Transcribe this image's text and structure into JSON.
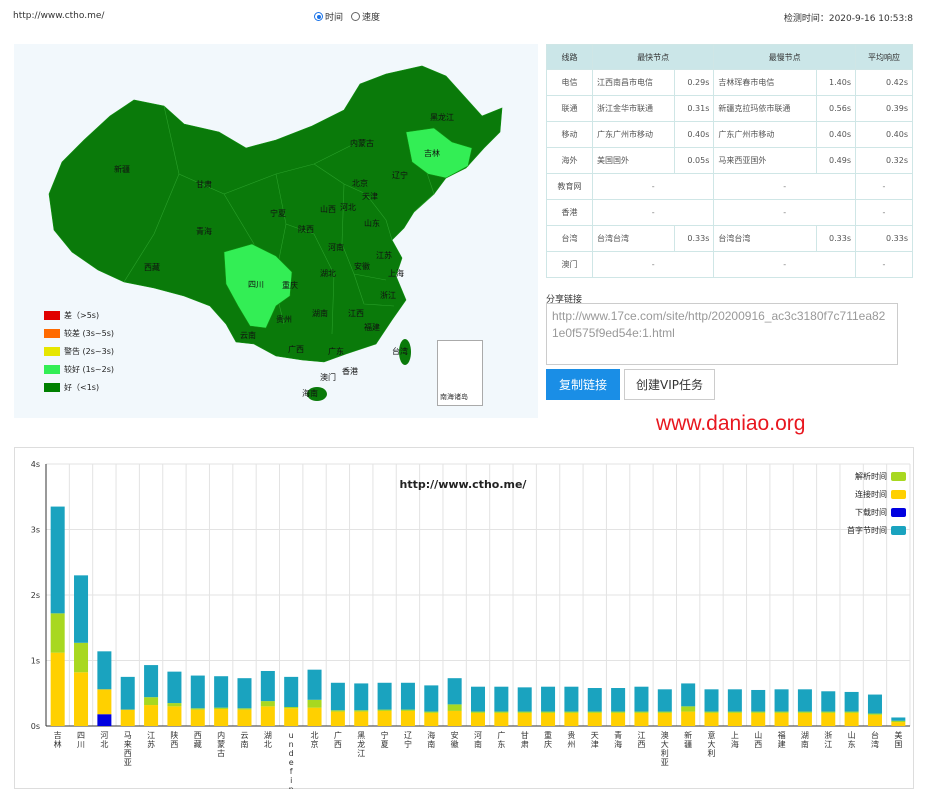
{
  "header": {
    "url": "http://www.ctho.me/",
    "radio_time": "时间",
    "radio_speed": "速度",
    "detect_time": "检测时间：2020-9-16 10:53:8"
  },
  "map": {
    "provinces": [
      {
        "name": "新疆",
        "status": "good"
      },
      {
        "name": "西藏",
        "status": "good"
      },
      {
        "name": "青海",
        "status": "good"
      },
      {
        "name": "甘肃",
        "status": "good"
      },
      {
        "name": "内蒙古",
        "status": "good"
      },
      {
        "name": "黑龙江",
        "status": "good"
      },
      {
        "name": "吉林",
        "status": "fair"
      },
      {
        "name": "辽宁",
        "status": "good"
      },
      {
        "name": "北京",
        "status": "good"
      },
      {
        "name": "天津",
        "status": "good"
      },
      {
        "name": "河北",
        "status": "good"
      },
      {
        "name": "山西",
        "status": "good"
      },
      {
        "name": "宁夏",
        "status": "good"
      },
      {
        "name": "陕西",
        "status": "good"
      },
      {
        "name": "山东",
        "status": "good"
      },
      {
        "name": "河南",
        "status": "good"
      },
      {
        "name": "江苏",
        "status": "good"
      },
      {
        "name": "安徽",
        "status": "good"
      },
      {
        "name": "上海",
        "status": "good"
      },
      {
        "name": "湖北",
        "status": "good"
      },
      {
        "name": "重庆",
        "status": "good"
      },
      {
        "name": "四川",
        "status": "fair"
      },
      {
        "name": "浙江",
        "status": "good"
      },
      {
        "name": "江西",
        "status": "good"
      },
      {
        "name": "湖南",
        "status": "good"
      },
      {
        "name": "贵州",
        "status": "good"
      },
      {
        "name": "福建",
        "status": "good"
      },
      {
        "name": "台湾",
        "status": "good"
      },
      {
        "name": "云南",
        "status": "good"
      },
      {
        "name": "广西",
        "status": "good"
      },
      {
        "name": "广东",
        "status": "good"
      },
      {
        "name": "香港",
        "status": "good"
      },
      {
        "name": "澳门",
        "status": "good"
      },
      {
        "name": "海南",
        "status": "good"
      }
    ],
    "inset_label": "南海诸岛",
    "legend": [
      {
        "label": "差（>5s)",
        "color": "#e00000"
      },
      {
        "label": "较差 (3s~5s)",
        "color": "#ff6a00"
      },
      {
        "label": "警告 (2s~3s)",
        "color": "#e6e600"
      },
      {
        "label": "较好 (1s~2s)",
        "color": "#33ee55"
      },
      {
        "label": "好（<1s)",
        "color": "#008000"
      }
    ]
  },
  "table": {
    "headers": [
      "线路",
      "最快节点",
      "最慢节点",
      "平均响应"
    ],
    "rows": [
      {
        "line": "电信",
        "fast_node": "江西南昌市电信",
        "fast_time": "0.29s",
        "slow_node": "吉林珲春市电信",
        "slow_time": "1.40s",
        "avg": "0.42s"
      },
      {
        "line": "联通",
        "fast_node": "浙江金华市联通",
        "fast_time": "0.31s",
        "slow_node": "新疆克拉玛依市联通",
        "slow_time": "0.56s",
        "avg": "0.39s"
      },
      {
        "line": "移动",
        "fast_node": "广东广州市移动",
        "fast_time": "0.40s",
        "slow_node": "广东广州市移动",
        "slow_time": "0.40s",
        "avg": "0.40s"
      },
      {
        "line": "海外",
        "fast_node": "美国国外",
        "fast_time": "0.05s",
        "slow_node": "马来西亚国外",
        "slow_time": "0.49s",
        "avg": "0.32s"
      },
      {
        "line": "教育网",
        "fast_node": "-",
        "fast_time": "",
        "slow_node": "-",
        "slow_time": "",
        "avg": "-"
      },
      {
        "line": "香港",
        "fast_node": "-",
        "fast_time": "",
        "slow_node": "-",
        "slow_time": "",
        "avg": "-"
      },
      {
        "line": "台湾",
        "fast_node": "台湾台湾",
        "fast_time": "0.33s",
        "slow_node": "台湾台湾",
        "slow_time": "0.33s",
        "avg": "0.33s"
      },
      {
        "line": "澳门",
        "fast_node": "-",
        "fast_time": "",
        "slow_node": "-",
        "slow_time": "",
        "avg": "-"
      }
    ]
  },
  "share": {
    "label": "分享链接",
    "link": "http://www.17ce.com/site/http/20200916_ac3c3180f7c711ea821e0f575f9ed54e:1.html",
    "copy_button": "复制链接",
    "vip_button": "创建VIP任务"
  },
  "watermark": "www.daniao.org",
  "chart_data": {
    "type": "bar",
    "stacked": true,
    "title": "http://www.ctho.me/",
    "ylim": [
      0,
      4
    ],
    "yticks": [
      "0s",
      "1s",
      "2s",
      "3s",
      "4s"
    ],
    "grid": true,
    "legend_position": "top-right",
    "categories": [
      "吉林",
      "四川",
      "河北",
      "马来西亚",
      "江苏",
      "陕西",
      "西藏",
      "内蒙古",
      "云南",
      "湖北",
      "undefined",
      "北京",
      "广西",
      "黑龙江",
      "宁夏",
      "辽宁",
      "海南",
      "安徽",
      "河南",
      "广东",
      "甘肃",
      "重庆",
      "贵州",
      "天津",
      "青海",
      "江西",
      "澳大利亚",
      "新疆",
      "意大利",
      "上海",
      "山西",
      "福建",
      "湖南",
      "浙江",
      "山东",
      "台湾",
      "美国"
    ],
    "series": [
      {
        "name": "解析时间",
        "color": "#a8d820",
        "values": [
          0.6,
          0.45,
          0,
          0,
          0.12,
          0.05,
          0.02,
          0.02,
          0.02,
          0.08,
          0.02,
          0.12,
          0.02,
          0.02,
          0.02,
          0.02,
          0.02,
          0.1,
          0.02,
          0.02,
          0.02,
          0.02,
          0.02,
          0.02,
          0.02,
          0.02,
          0.02,
          0.08,
          0.02,
          0.02,
          0.02,
          0.02,
          0.02,
          0.02,
          0.02,
          0.02,
          0.02
        ]
      },
      {
        "name": "连接时间",
        "color": "#ffd000",
        "values": [
          1.12,
          0.82,
          0.38,
          0.25,
          0.32,
          0.3,
          0.25,
          0.26,
          0.25,
          0.3,
          0.27,
          0.28,
          0.22,
          0.22,
          0.23,
          0.23,
          0.2,
          0.23,
          0.2,
          0.2,
          0.2,
          0.2,
          0.2,
          0.2,
          0.2,
          0.2,
          0.2,
          0.22,
          0.2,
          0.2,
          0.2,
          0.2,
          0.2,
          0.2,
          0.2,
          0.17,
          0.06
        ]
      },
      {
        "name": "下载时间",
        "color": "#0000e0",
        "values": [
          0,
          0,
          0.18,
          0,
          0,
          0,
          0,
          0,
          0,
          0,
          0,
          0,
          0,
          0,
          0,
          0,
          0,
          0,
          0,
          0,
          0,
          0,
          0,
          0,
          0,
          0,
          0,
          0,
          0,
          0,
          0,
          0,
          0,
          0,
          0,
          0,
          0
        ]
      },
      {
        "name": "首字节时间",
        "color": "#1aa3bf",
        "values": [
          1.63,
          1.03,
          0.58,
          0.5,
          0.49,
          0.48,
          0.5,
          0.48,
          0.46,
          0.46,
          0.46,
          0.46,
          0.42,
          0.41,
          0.41,
          0.41,
          0.4,
          0.4,
          0.38,
          0.38,
          0.37,
          0.38,
          0.38,
          0.36,
          0.36,
          0.38,
          0.34,
          0.35,
          0.34,
          0.34,
          0.33,
          0.34,
          0.34,
          0.31,
          0.3,
          0.29,
          0.05
        ]
      }
    ]
  }
}
